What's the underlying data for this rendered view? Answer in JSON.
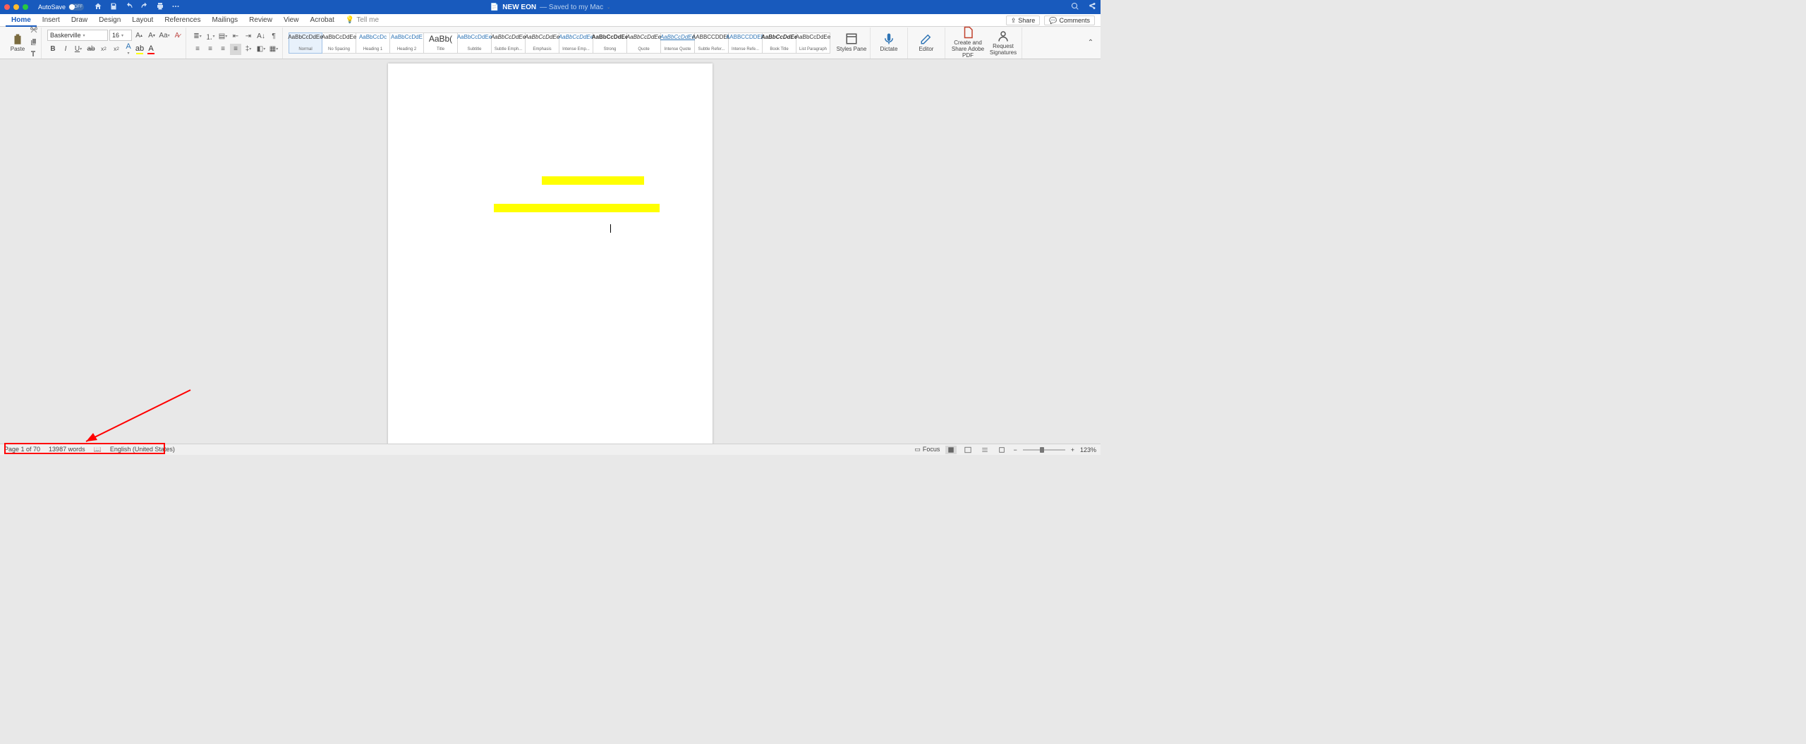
{
  "titlebar": {
    "autosave_label": "AutoSave",
    "autosave_state": "OFF",
    "doc_icon": "📄",
    "doc_name": "NEW EON",
    "saved_text": "— Saved to my Mac",
    "chev": "⌄"
  },
  "tabs": {
    "items": [
      "Home",
      "Insert",
      "Draw",
      "Design",
      "Layout",
      "References",
      "Mailings",
      "Review",
      "View",
      "Acrobat"
    ],
    "active": 0,
    "tell_me": "Tell me",
    "share": "Share",
    "comments": "Comments"
  },
  "ribbon": {
    "paste": "Paste",
    "font_name": "Baskerville",
    "font_size": "16",
    "styles": [
      {
        "preview": "AaBbCcDdEe",
        "label": "Normal",
        "sel": true
      },
      {
        "preview": "AaBbCcDdEe",
        "label": "No Spacing"
      },
      {
        "preview": "AaBbCcDc",
        "label": "Heading 1",
        "cls": "blue"
      },
      {
        "preview": "AaBbCcDdE",
        "label": "Heading 2",
        "cls": "blue"
      },
      {
        "preview": "AaBb(",
        "label": "Title",
        "cls": "big"
      },
      {
        "preview": "AaBbCcDdEe",
        "label": "Subtitle",
        "cls": "blue"
      },
      {
        "preview": "AaBbCcDdEe",
        "label": "Subtle Emph...",
        "cls": "ital"
      },
      {
        "preview": "AaBbCcDdEe",
        "label": "Emphasis",
        "cls": "ital"
      },
      {
        "preview": "AaBbCcDdEe",
        "label": "Intense Emp...",
        "cls": "blue ital"
      },
      {
        "preview": "AaBbCcDdEe",
        "label": "Strong",
        "cls": "bold"
      },
      {
        "preview": "AaBbCcDdEe",
        "label": "Quote",
        "cls": "ital"
      },
      {
        "preview": "AaBbCcDdEe",
        "label": "Intense Quote",
        "cls": "blue ital under"
      },
      {
        "preview": "AABBCCDDEE",
        "label": "Subtle Refer..."
      },
      {
        "preview": "AABBCCDDEE",
        "label": "Intense Refe...",
        "cls": "blue"
      },
      {
        "preview": "AaBbCcDdEe",
        "label": "Book Title",
        "cls": "bold ital"
      },
      {
        "preview": "AaBbCcDdEe",
        "label": "List Paragraph"
      }
    ],
    "styles_pane": "Styles Pane",
    "dictate": "Dictate",
    "editor": "Editor",
    "create_share": "Create and Share Adobe PDF",
    "request_sig": "Request Signatures"
  },
  "status": {
    "page": "Page 1 of 70",
    "words": "13987 words",
    "lang": "English (United States)",
    "focus": "Focus",
    "zoom": "123%"
  },
  "colors": {
    "brand": "#185abd",
    "highlight": "#ffff00",
    "anno": "#ff0000"
  }
}
